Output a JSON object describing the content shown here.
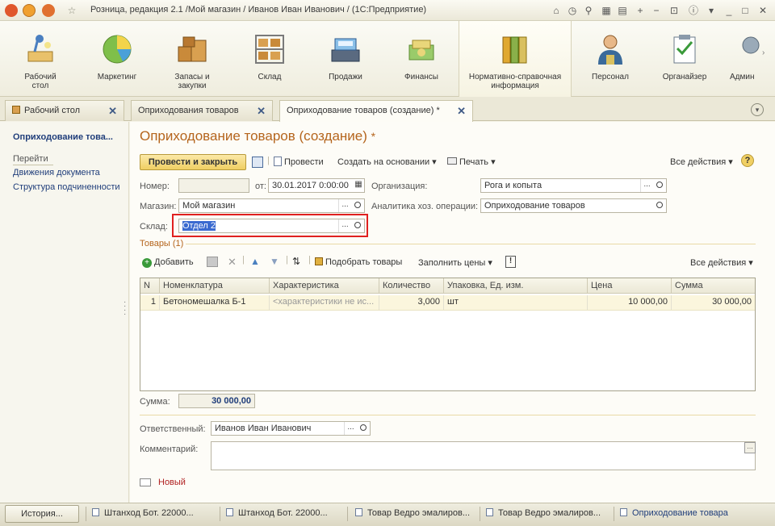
{
  "window": {
    "title": "Розница, редакция 2.1 /Мой магазин / Иванов Иван Иванович /  (1С:Предприятие)"
  },
  "sections": [
    {
      "label": "Рабочий\nстол",
      "icon": "desk-lamp-icon"
    },
    {
      "label": "Маркетинг",
      "icon": "pie-chart-icon"
    },
    {
      "label": "Запасы и\nзакупки",
      "icon": "boxes-icon"
    },
    {
      "label": "Склад",
      "icon": "warehouse-shelf-icon"
    },
    {
      "label": "Продажи",
      "icon": "cash-register-icon"
    },
    {
      "label": "Финансы",
      "icon": "money-stack-icon"
    },
    {
      "label": "Нормативно-справочная\nинформация",
      "icon": "binders-icon"
    },
    {
      "label": "Персонал",
      "icon": "person-icon"
    },
    {
      "label": "Органайзер",
      "icon": "checklist-icon"
    },
    {
      "label": "Админ",
      "icon": "admin-icon"
    }
  ],
  "tabs": [
    {
      "label": "Рабочий стол"
    },
    {
      "label": "Оприходования товаров"
    },
    {
      "label": "Оприходование товаров (создание) *"
    }
  ],
  "leftnav": {
    "header": "Оприходование това...",
    "links": [
      "Перейти",
      "Движения документа",
      "Структура подчиненности"
    ]
  },
  "form": {
    "title": "Оприходование товаров (создание)",
    "modified_mark": "*",
    "toolbar": {
      "post_close": "Провести и закрыть",
      "post": "Провести",
      "create_based": "Создать на основании",
      "print": "Печать",
      "all_actions": "Все действия"
    },
    "fields": {
      "number_label": "Номер:",
      "number_value": "",
      "date_label": "от:",
      "date_value": "30.01.2017  0:00:00",
      "org_label": "Организация:",
      "org_value": "Рога и копыта",
      "store_label": "Магазин:",
      "store_value": "Мой магазин",
      "analytics_label": "Аналитика хоз. операции:",
      "analytics_value": "Оприходование товаров",
      "warehouse_label": "Склад:",
      "warehouse_value": "Отдел 2"
    },
    "goods": {
      "header": "Товары (1)",
      "toolbar": {
        "add": "Добавить",
        "pick": "Подобрать товары",
        "fill_prices": "Заполнить цены",
        "all_actions": "Все действия"
      },
      "columns": [
        "N",
        "Номенклатура",
        "Характеристика",
        "Количество",
        "Упаковка, Ед. изм.",
        "Цена",
        "Сумма"
      ],
      "rows": [
        {
          "n": "1",
          "item": "Бетономешалка Б-1",
          "char": "<характеристики не ис...",
          "qty": "3,000",
          "unit": "шт",
          "price": "10 000,00",
          "sum": "30 000,00"
        }
      ]
    },
    "total_label": "Сумма:",
    "total_value": "30 000,00",
    "responsible_label": "Ответственный:",
    "responsible_value": "Иванов Иван Иванович",
    "comment_label": "Комментарий:",
    "comment_value": "",
    "status": "Новый"
  },
  "bottombar": {
    "history": "История...",
    "tasks": [
      "Штанход Бот. 22000...",
      "Штанход Бот. 22000...",
      "Товар Ведро эмалиров...",
      "Товар Ведро эмалиров...",
      "Оприходование товара"
    ]
  },
  "colors": {
    "accent_orange": "#b5651d",
    "link_blue": "#1f3d7a",
    "highlight_red": "#e02020",
    "button_yellow": "#f0cf63"
  }
}
